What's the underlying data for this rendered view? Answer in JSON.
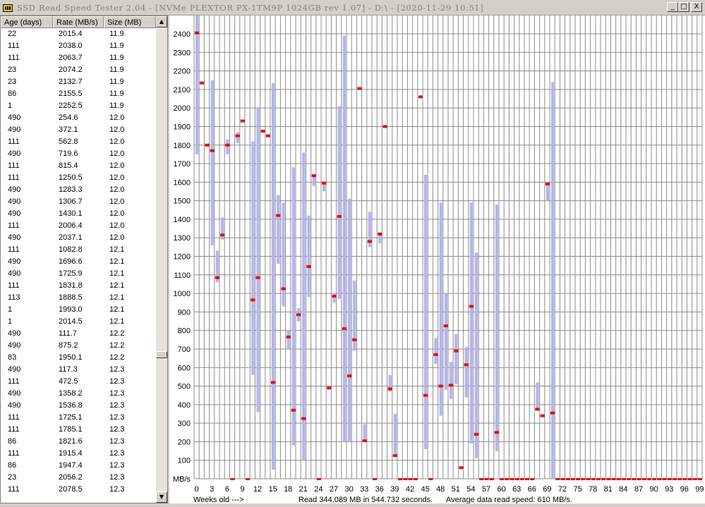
{
  "window": {
    "title": "SSD Read Speed Tester 2.04 - [NVMe PLEXTOR PX-1TM9P 1024GB rev 1.07] - D:\\ - [2020-11-29 10:51]",
    "minimize_label": "_",
    "maximize_label": "□",
    "close_label": "X"
  },
  "list": {
    "headers": [
      "Age (days)",
      "Rate (MB/s)",
      "Size (MB)"
    ],
    "rows": [
      [
        "22",
        "2015.4",
        "11.9"
      ],
      [
        "111",
        "2038.0",
        "11.9"
      ],
      [
        "111",
        "2063.7",
        "11.9"
      ],
      [
        "23",
        "2074.2",
        "11.9"
      ],
      [
        "23",
        "2132.7",
        "11.9"
      ],
      [
        "86",
        "2155.5",
        "11.9"
      ],
      [
        "1",
        "2252.5",
        "11.9"
      ],
      [
        "490",
        "254.6",
        "12.0"
      ],
      [
        "490",
        "372.1",
        "12.0"
      ],
      [
        "111",
        "562.8",
        "12.0"
      ],
      [
        "490",
        "719.6",
        "12.0"
      ],
      [
        "111",
        "815.4",
        "12.0"
      ],
      [
        "111",
        "1250.5",
        "12.0"
      ],
      [
        "490",
        "1283.3",
        "12.0"
      ],
      [
        "490",
        "1306.7",
        "12.0"
      ],
      [
        "490",
        "1430.1",
        "12.0"
      ],
      [
        "111",
        "2006.4",
        "12.0"
      ],
      [
        "490",
        "2037.1",
        "12.0"
      ],
      [
        "111",
        "1082.8",
        "12.1"
      ],
      [
        "490",
        "1696.6",
        "12.1"
      ],
      [
        "490",
        "1725.9",
        "12.1"
      ],
      [
        "111",
        "1831.8",
        "12.1"
      ],
      [
        "113",
        "1888.5",
        "12.1"
      ],
      [
        "1",
        "1993.0",
        "12.1"
      ],
      [
        "1",
        "2014.5",
        "12.1"
      ],
      [
        "490",
        "111.7",
        "12.2"
      ],
      [
        "490",
        "875.2",
        "12.2"
      ],
      [
        "83",
        "1950.1",
        "12.2"
      ],
      [
        "490",
        "117.3",
        "12.3"
      ],
      [
        "111",
        "472.5",
        "12.3"
      ],
      [
        "490",
        "1358.2",
        "12.3"
      ],
      [
        "490",
        "1536.8",
        "12.3"
      ],
      [
        "111",
        "1725.1",
        "12.3"
      ],
      [
        "111",
        "1785.1",
        "12.3"
      ],
      [
        "86",
        "1821.6",
        "12.3"
      ],
      [
        "111",
        "1915.4",
        "12.3"
      ],
      [
        "86",
        "1947.4",
        "12.3"
      ],
      [
        "23",
        "2056.2",
        "12.3"
      ],
      [
        "111",
        "2078.5",
        "12.3"
      ]
    ],
    "scroll_up_icon": "up-arrow",
    "scroll_down_icon": "down-arrow"
  },
  "chart_data": {
    "type": "bar",
    "description_type": "range-bars-with-average-markers",
    "y_unit_label": "MB/s",
    "x_label": "Weeks old --->",
    "ylim": [
      0,
      2500
    ],
    "y_ticks": [
      100,
      200,
      300,
      400,
      500,
      600,
      700,
      800,
      900,
      1000,
      1100,
      1200,
      1300,
      1400,
      1500,
      1600,
      1700,
      1800,
      1900,
      2000,
      2100,
      2200,
      2300,
      2400
    ],
    "x_ticks": [
      0,
      3,
      6,
      9,
      12,
      15,
      18,
      21,
      24,
      27,
      30,
      33,
      36,
      39,
      42,
      45,
      48,
      51,
      54,
      57,
      60,
      63,
      66,
      69,
      72,
      75,
      78,
      81,
      84,
      87,
      90,
      93,
      96,
      99
    ],
    "x_max": 99,
    "grid": true,
    "colors": {
      "range": "#b4b4f0",
      "average": "#e01010",
      "grid": "#8c8c8c"
    },
    "weeks": [
      {
        "week": 0,
        "min": 1750,
        "max": 2500,
        "avg": 2405
      },
      {
        "week": 1,
        "avg": 2135
      },
      {
        "week": 2,
        "avg": 1800
      },
      {
        "week": 3,
        "min": 1260,
        "max": 2150,
        "avg": 1770
      },
      {
        "week": 4,
        "min": 1060,
        "max": 1230,
        "avg": 1085
      },
      {
        "week": 5,
        "min": 1290,
        "max": 1410,
        "avg": 1315
      },
      {
        "week": 6,
        "min": 1750,
        "max": 1830,
        "avg": 1800
      },
      {
        "week": 7,
        "avg": 0
      },
      {
        "week": 8,
        "min": 1810,
        "max": 1870,
        "avg": 1850
      },
      {
        "week": 9,
        "avg": 1930
      },
      {
        "week": 10,
        "avg": 0
      },
      {
        "week": 11,
        "min": 560,
        "max": 1820,
        "avg": 965
      },
      {
        "week": 12,
        "min": 360,
        "max": 2000,
        "avg": 1085
      },
      {
        "week": 13,
        "avg": 1875
      },
      {
        "week": 14,
        "avg": 1850
      },
      {
        "week": 15,
        "min": 50,
        "max": 2135,
        "avg": 520
      },
      {
        "week": 16,
        "min": 1160,
        "max": 1530,
        "avg": 1420
      },
      {
        "week": 17,
        "min": 930,
        "max": 1490,
        "avg": 1025
      },
      {
        "week": 18,
        "min": 700,
        "max": 800,
        "avg": 765
      },
      {
        "week": 19,
        "min": 180,
        "max": 1680,
        "avg": 370
      },
      {
        "week": 20,
        "min": 850,
        "max": 920,
        "avg": 885
      },
      {
        "week": 21,
        "min": 100,
        "max": 1760,
        "avg": 325
      },
      {
        "week": 22,
        "min": 980,
        "max": 1420,
        "avg": 1145
      },
      {
        "week": 23,
        "min": 1580,
        "max": 1640,
        "avg": 1635
      },
      {
        "week": 24,
        "avg": 0
      },
      {
        "week": 25,
        "min": 1550,
        "max": 1600,
        "avg": 1595
      },
      {
        "week": 26,
        "avg": 490
      },
      {
        "week": 27,
        "min": 950,
        "max": 1000,
        "avg": 985
      },
      {
        "week": 28,
        "min": 970,
        "max": 2010,
        "avg": 1415
      },
      {
        "week": 29,
        "min": 200,
        "max": 2390,
        "avg": 810
      },
      {
        "week": 30,
        "min": 200,
        "max": 1510,
        "avg": 555
      },
      {
        "week": 31,
        "min": 690,
        "max": 1070,
        "avg": 750
      },
      {
        "week": 32,
        "avg": 2105
      },
      {
        "week": 33,
        "min": 200,
        "max": 295,
        "avg": 205
      },
      {
        "week": 34,
        "min": 1250,
        "max": 1440,
        "avg": 1280
      },
      {
        "week": 35,
        "avg": 0
      },
      {
        "week": 36,
        "min": 1270,
        "max": 1330,
        "avg": 1320
      },
      {
        "week": 37,
        "avg": 1900
      },
      {
        "week": 38,
        "min": 470,
        "max": 560,
        "avg": 485
      },
      {
        "week": 39,
        "min": 120,
        "max": 350,
        "avg": 125
      },
      {
        "week": 40,
        "avg": 0
      },
      {
        "week": 41,
        "avg": 0
      },
      {
        "week": 42,
        "avg": 0
      },
      {
        "week": 43,
        "avg": 0
      },
      {
        "week": 44,
        "avg": 2060
      },
      {
        "week": 45,
        "min": 160,
        "max": 1640,
        "avg": 450
      },
      {
        "week": 46,
        "avg": 0
      },
      {
        "week": 47,
        "min": 620,
        "max": 760,
        "avg": 670
      },
      {
        "week": 48,
        "min": 340,
        "max": 1490,
        "avg": 500
      },
      {
        "week": 49,
        "min": 480,
        "max": 1000,
        "avg": 825
      },
      {
        "week": 50,
        "min": 430,
        "max": 630,
        "avg": 505
      },
      {
        "week": 51,
        "min": 510,
        "max": 780,
        "avg": 690
      },
      {
        "week": 52,
        "avg": 60
      },
      {
        "week": 53,
        "min": 440,
        "max": 710,
        "avg": 615
      },
      {
        "week": 54,
        "min": 190,
        "max": 1490,
        "avg": 930
      },
      {
        "week": 55,
        "min": 110,
        "max": 1220,
        "avg": 240
      },
      {
        "week": 56,
        "avg": 0
      },
      {
        "week": 57,
        "avg": 0
      },
      {
        "week": 58,
        "avg": 0
      },
      {
        "week": 59,
        "min": 150,
        "max": 1480,
        "avg": 250
      },
      {
        "week": 60,
        "avg": 0
      },
      {
        "week": 61,
        "avg": 0
      },
      {
        "week": 62,
        "avg": 0
      },
      {
        "week": 63,
        "avg": 0
      },
      {
        "week": 64,
        "avg": 0
      },
      {
        "week": 65,
        "avg": 0
      },
      {
        "week": 66,
        "avg": 0
      },
      {
        "week": 67,
        "min": 370,
        "max": 520,
        "avg": 375
      },
      {
        "week": 68,
        "avg": 340
      },
      {
        "week": 69,
        "min": 1500,
        "max": 1600,
        "avg": 1590
      },
      {
        "week": 70,
        "min": 0,
        "max": 2140,
        "avg": 355
      },
      {
        "week": 71,
        "avg": 0
      },
      {
        "week": 72,
        "avg": 0
      },
      {
        "week": 73,
        "avg": 0
      },
      {
        "week": 74,
        "avg": 0
      },
      {
        "week": 75,
        "avg": 0
      },
      {
        "week": 76,
        "avg": 0
      },
      {
        "week": 77,
        "avg": 0
      },
      {
        "week": 78,
        "avg": 0
      },
      {
        "week": 79,
        "avg": 0
      },
      {
        "week": 80,
        "avg": 0
      },
      {
        "week": 81,
        "avg": 0
      },
      {
        "week": 82,
        "avg": 0
      },
      {
        "week": 83,
        "avg": 0
      },
      {
        "week": 84,
        "avg": 0
      },
      {
        "week": 85,
        "avg": 0
      },
      {
        "week": 86,
        "avg": 0
      },
      {
        "week": 87,
        "avg": 0
      },
      {
        "week": 88,
        "avg": 0
      },
      {
        "week": 89,
        "avg": 0
      },
      {
        "week": 90,
        "avg": 0
      },
      {
        "week": 91,
        "avg": 0
      },
      {
        "week": 92,
        "avg": 0
      },
      {
        "week": 93,
        "avg": 0
      },
      {
        "week": 94,
        "avg": 0
      },
      {
        "week": 95,
        "avg": 0
      },
      {
        "week": 96,
        "avg": 0
      },
      {
        "week": 97,
        "avg": 0
      },
      {
        "week": 98,
        "avg": 0
      },
      {
        "week": 99,
        "avg": 0
      }
    ]
  },
  "footer": {
    "read_summary": "Read 344,089 MB in 544.732 seconds.",
    "average_speed": "Average data read speed: 610 MB/s."
  }
}
